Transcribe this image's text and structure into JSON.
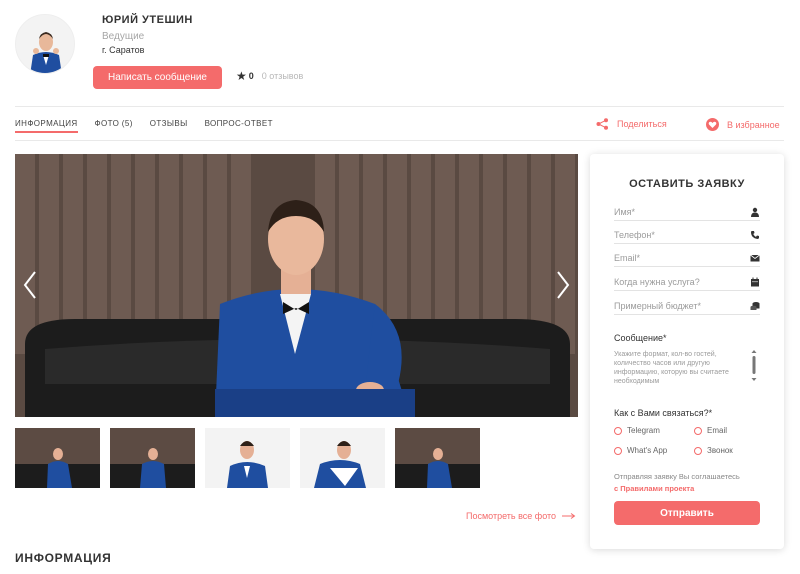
{
  "profile": {
    "name": "ЮРИЙ УТЕШИН",
    "role": "Ведущие",
    "city": "г. Саратов",
    "message_button": "Написать сообщение",
    "rating": "0",
    "reviews": "0 отзывов"
  },
  "tabs": [
    {
      "label": "ИНФОРМАЦИЯ",
      "active": true
    },
    {
      "label": "ФОТО (5)",
      "active": false
    },
    {
      "label": "ОТЗЫВЫ",
      "active": false
    },
    {
      "label": "ВОПРОС-ОТВЕТ",
      "active": false
    }
  ],
  "actions": {
    "share": "Поделиться",
    "favorite": "В избранное"
  },
  "gallery": {
    "thumbnail_count": 5,
    "see_all": "Посмотреть все фото"
  },
  "section_title": "ИНФОРМАЦИЯ",
  "form": {
    "title": "ОСТАВИТЬ ЗАЯВКУ",
    "fields": [
      {
        "label": "Имя*",
        "icon": "user-icon"
      },
      {
        "label": "Телефон*",
        "icon": "phone-icon"
      },
      {
        "label": "Email*",
        "icon": "mail-icon"
      },
      {
        "label": "Когда нужна услуга?",
        "icon": "calendar-icon"
      },
      {
        "label": "Примерный бюджет*",
        "icon": "coins-icon"
      }
    ],
    "message_label": "Сообщение*",
    "message_placeholder": "Укажите формат, кол-во гостей, количество часов или другую информацию, которую вы считаете необходимым",
    "contact_label": "Как с Вами связаться?*",
    "contact_options": [
      "Telegram",
      "Email",
      "What's App",
      "Звонок"
    ],
    "agreement_text": "Отправляя заявку Вы соглашаетесь",
    "agreement_link": "с Правилами проекта",
    "submit": "Отправить"
  },
  "colors": {
    "accent": "#f46b6b",
    "text": "#333333",
    "muted": "#9b9b9b"
  }
}
